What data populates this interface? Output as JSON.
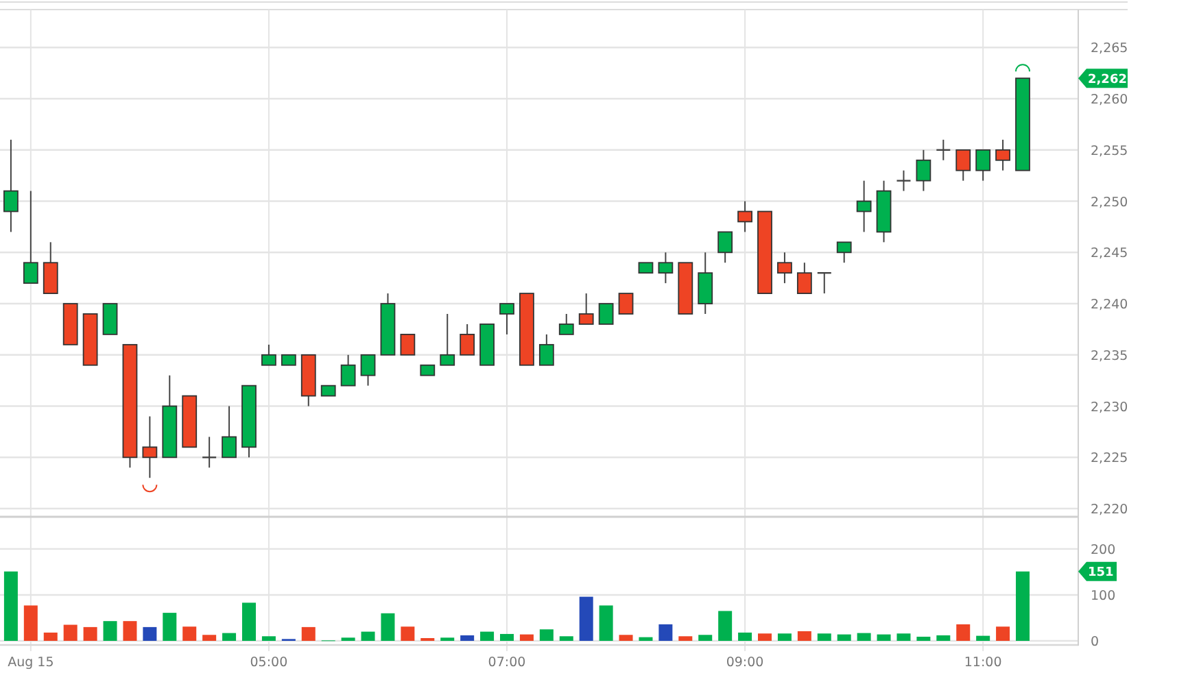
{
  "price_chart": {
    "last_price_tag": "2,262",
    "chart_data": {
      "type": "candlestick",
      "x": [
        170,
        180,
        190,
        200,
        210,
        220,
        230,
        240,
        250,
        260,
        270,
        280,
        290,
        300,
        310,
        320,
        330,
        340,
        350,
        360,
        370,
        380,
        390,
        400,
        410,
        420,
        430,
        440,
        450,
        460,
        470,
        480,
        490,
        500,
        510,
        520,
        530,
        540,
        550,
        560,
        570,
        580,
        590,
        600,
        610,
        620,
        630,
        640,
        650,
        660,
        670,
        680
      ],
      "ohlc": [
        [
          2249,
          2256,
          2247,
          2251
        ],
        [
          2242,
          2251,
          2242,
          2244
        ],
        [
          2244,
          2246,
          2241,
          2241
        ],
        [
          2240,
          2240,
          2236,
          2236
        ],
        [
          2239,
          2239,
          2234,
          2234
        ],
        [
          2237,
          2240,
          2237,
          2240
        ],
        [
          2236,
          2236,
          2224,
          2225
        ],
        [
          2226,
          2229,
          2223,
          2225
        ],
        [
          2225,
          2233,
          2225,
          2230
        ],
        [
          2231,
          2231,
          2226,
          2226
        ],
        [
          2225,
          2227,
          2224,
          2225
        ],
        [
          2225,
          2230,
          2225,
          2227
        ],
        [
          2226,
          2232,
          2225,
          2232
        ],
        [
          2234,
          2236,
          2234,
          2235
        ],
        [
          2234,
          2235,
          2234,
          2235
        ],
        [
          2235,
          2235,
          2230,
          2231
        ],
        [
          2231,
          2232,
          2231,
          2232
        ],
        [
          2232,
          2235,
          2232,
          2234
        ],
        [
          2233,
          2235,
          2232,
          2235
        ],
        [
          2235,
          2241,
          2235,
          2240
        ],
        [
          2237,
          2237,
          2235,
          2235
        ],
        [
          2233,
          2234,
          2233,
          2234
        ],
        [
          2234,
          2239,
          2234,
          2235
        ],
        [
          2237,
          2238,
          2235,
          2235
        ],
        [
          2234,
          2238,
          2234,
          2238
        ],
        [
          2239,
          2240,
          2237,
          2240
        ],
        [
          2241,
          2241,
          2234,
          2234
        ],
        [
          2234,
          2237,
          2234,
          2236
        ],
        [
          2237,
          2239,
          2237,
          2238
        ],
        [
          2239,
          2241,
          2238,
          2238
        ],
        [
          2238,
          2240,
          2238,
          2240
        ],
        [
          2241,
          2241,
          2239,
          2239
        ],
        [
          2243,
          2244,
          2243,
          2244
        ],
        [
          2243,
          2245,
          2242,
          2244
        ],
        [
          2244,
          2244,
          2239,
          2239
        ],
        [
          2240,
          2245,
          2239,
          2243
        ],
        [
          2245,
          2247,
          2244,
          2247
        ],
        [
          2249,
          2250,
          2247,
          2248
        ],
        [
          2249,
          2249,
          2241,
          2241
        ],
        [
          2244,
          2245,
          2242,
          2243
        ],
        [
          2243,
          2244,
          2241,
          2241
        ],
        [
          2243,
          2243,
          2241,
          2243
        ],
        [
          2245,
          2246,
          2244,
          2246
        ],
        [
          2249,
          2252,
          2247,
          2250
        ],
        [
          2247,
          2252,
          2246,
          2251
        ],
        [
          2252,
          2253,
          2251,
          2252
        ],
        [
          2252,
          2255,
          2251,
          2254
        ],
        [
          2255,
          2256,
          2254,
          2255
        ],
        [
          2255,
          2255,
          2252,
          2253
        ],
        [
          2253,
          2255,
          2252,
          2255
        ],
        [
          2255,
          2256,
          2253,
          2254
        ],
        [
          2253,
          2262,
          2253,
          2262
        ]
      ],
      "xlim": [
        164.5,
        708
      ],
      "ylim": [
        2219.2,
        2268.7
      ],
      "grid": true,
      "yticks": [
        {
          "value": 2220,
          "label": "2,220"
        },
        {
          "value": 2225,
          "label": "2,225"
        },
        {
          "value": 2230,
          "label": "2,230"
        },
        {
          "value": 2235,
          "label": "2,235"
        },
        {
          "value": 2240,
          "label": "2,240"
        },
        {
          "value": 2245,
          "label": "2,245"
        },
        {
          "value": 2250,
          "label": "2,250"
        },
        {
          "value": 2255,
          "label": "2,255"
        },
        {
          "value": 2260,
          "label": "2,260"
        },
        {
          "value": 2265,
          "label": "2,265"
        }
      ]
    }
  },
  "volume_chart": {
    "last_volume_tag": "151",
    "chart_data": {
      "type": "bar",
      "x": [
        170,
        180,
        190,
        200,
        210,
        220,
        230,
        240,
        250,
        260,
        270,
        280,
        290,
        300,
        310,
        320,
        330,
        340,
        350,
        360,
        370,
        380,
        390,
        400,
        410,
        420,
        430,
        440,
        450,
        460,
        470,
        480,
        490,
        500,
        510,
        520,
        530,
        540,
        550,
        560,
        570,
        580,
        590,
        600,
        610,
        620,
        630,
        640,
        650,
        660,
        670,
        680
      ],
      "series": [
        {
          "values": [
            151,
            77,
            18,
            35,
            30,
            43,
            43,
            30,
            61,
            31,
            13,
            17,
            83,
            10,
            4,
            30,
            1,
            7,
            20,
            60,
            31,
            6,
            7,
            12,
            20,
            15,
            14,
            25,
            10,
            96,
            77,
            13,
            8,
            36,
            10,
            13,
            65,
            18,
            16,
            16,
            21,
            16,
            14,
            17,
            14,
            16,
            9,
            12,
            36,
            11,
            31,
            151
          ]
        }
      ],
      "xlim": [
        164.5,
        708
      ],
      "ylim": [
        0,
        267
      ],
      "grid": true,
      "yticks": [
        0,
        100,
        200
      ],
      "xticks": [
        {
          "value": 180,
          "label": "Aug 15"
        },
        {
          "value": 300,
          "label": "05:00"
        },
        {
          "value": 420,
          "label": "07:00"
        },
        {
          "value": 540,
          "label": "09:00"
        },
        {
          "value": 660,
          "label": "11:00"
        }
      ]
    }
  }
}
